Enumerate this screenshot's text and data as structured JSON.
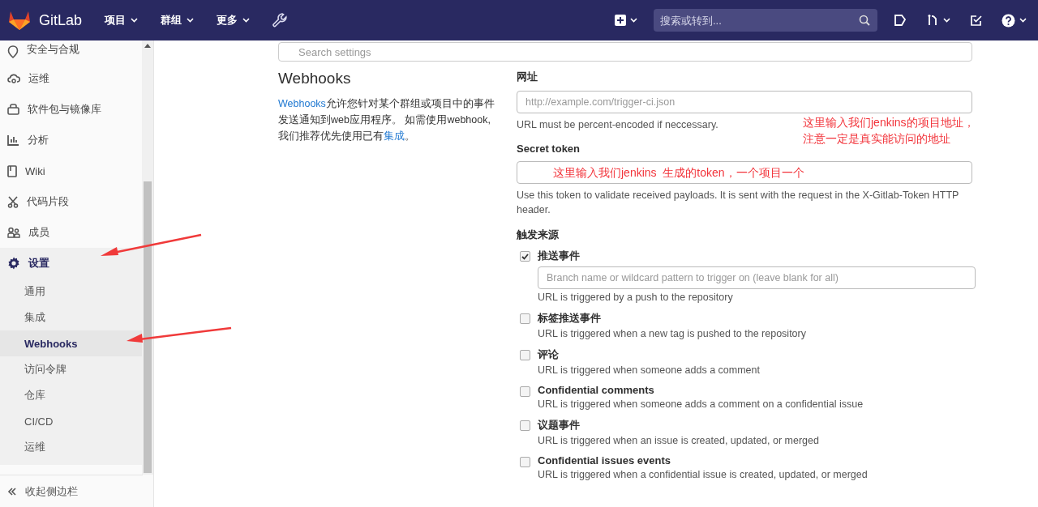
{
  "navbar": {
    "brand": "GitLab",
    "menus": [
      {
        "label": "项目"
      },
      {
        "label": "群组"
      },
      {
        "label": "更多"
      }
    ],
    "search": {
      "placeholder": "搜索或转到..."
    }
  },
  "sidebar": {
    "items": [
      {
        "label": "安全与合规",
        "selected": false
      },
      {
        "label": "运维",
        "selected": false
      },
      {
        "label": "软件包与镜像库",
        "selected": false
      },
      {
        "label": "分析",
        "selected": false
      },
      {
        "label": "Wiki",
        "selected": false
      },
      {
        "label": "代码片段",
        "selected": false
      },
      {
        "label": "成员",
        "selected": false
      },
      {
        "label": "设置",
        "selected": true,
        "children": [
          {
            "label": "通用",
            "selected": false
          },
          {
            "label": "集成",
            "selected": false
          },
          {
            "label": "Webhooks",
            "selected": true
          },
          {
            "label": "访问令牌",
            "selected": false
          },
          {
            "label": "仓库",
            "selected": false
          },
          {
            "label": "CI/CD",
            "selected": false
          },
          {
            "label": "运维",
            "selected": false
          }
        ]
      }
    ],
    "collapse": "收起侧边栏"
  },
  "search_settings": {
    "placeholder": "Search settings"
  },
  "intro": {
    "title": "Webhooks",
    "link": "Webhooks",
    "text": "允许您针对某个群组或项目中的事件发送通知到web应用程序。 如需使用webhook, 我们推荐优先使用已有",
    "link2": "集成",
    "end": "。"
  },
  "url_field": {
    "label": "网址",
    "placeholder": "http://example.com/trigger-ci.json",
    "help": "URL must be percent-encoded if neccessary."
  },
  "token_field": {
    "label": "Secret token",
    "help": "Use this token to validate received payloads. It is sent with the request in the X-Gitlab-Token HTTP header."
  },
  "triggers": {
    "title": "触发来源",
    "items": [
      {
        "label": "推送事件",
        "checked": true,
        "branch_placeholder": "Branch name or wildcard pattern to trigger on (leave blank for all)",
        "description": "URL is triggered by a push to the repository"
      },
      {
        "label": "标签推送事件",
        "checked": false,
        "description": "URL is triggered when a new tag is pushed to the repository"
      },
      {
        "label": "评论",
        "checked": false,
        "description": "URL is triggered when someone adds a comment"
      },
      {
        "label": "Confidential comments",
        "checked": false,
        "description": "URL is triggered when someone adds a comment on a confidential issue"
      },
      {
        "label": "议题事件",
        "checked": false,
        "description": "URL is triggered when an issue is created, updated, or merged"
      },
      {
        "label": "Confidential issues events",
        "checked": false,
        "description": "URL is triggered when a confidential issue is created, updated, or merged"
      }
    ]
  },
  "annotations": {
    "url_note": [
      "这里输入我们jenkins的项目地址，",
      "注意一定是真实能访问的地址"
    ],
    "token_note": "这里输入我们jenkins  生成的token，一个项目一个"
  }
}
